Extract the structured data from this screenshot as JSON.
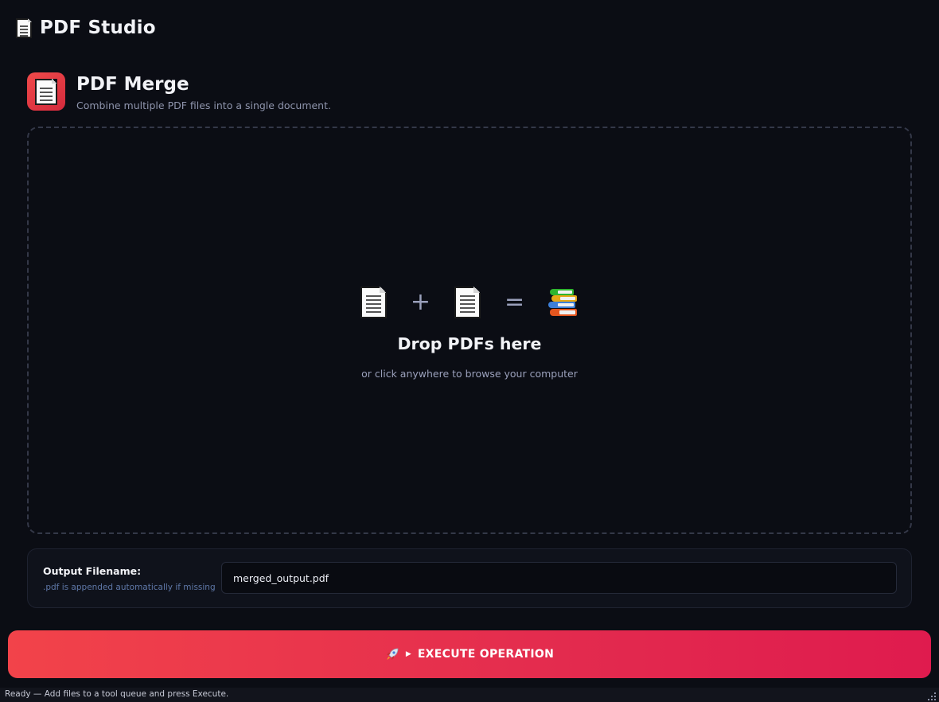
{
  "app": {
    "title": "PDF Studio",
    "icon": "document-icon"
  },
  "tool": {
    "title": "PDF Merge",
    "subtitle": "Combine multiple PDF files into a single document.",
    "icon": "document-icon",
    "accent": "#e8363f"
  },
  "dropzone": {
    "equation": {
      "plus": "+",
      "equals": "="
    },
    "title": "Drop PDFs here",
    "hint": "or click anywhere to browse your computer"
  },
  "output": {
    "label": "Output Filename:",
    "hint": ".pdf is appended automatically if missing",
    "value": "merged_output.pdf"
  },
  "execute": {
    "label": "EXECUTE OPERATION",
    "icons": [
      "rocket-icon",
      "play-icon"
    ],
    "gradient": [
      "#f2434a",
      "#df1b4e"
    ]
  },
  "status": {
    "text": "Ready — Add files to a tool queue and press Execute."
  },
  "colors": {
    "background": "#0b0d14",
    "muted": "#9aa0bb",
    "hint_blue": "#5f78a8"
  }
}
